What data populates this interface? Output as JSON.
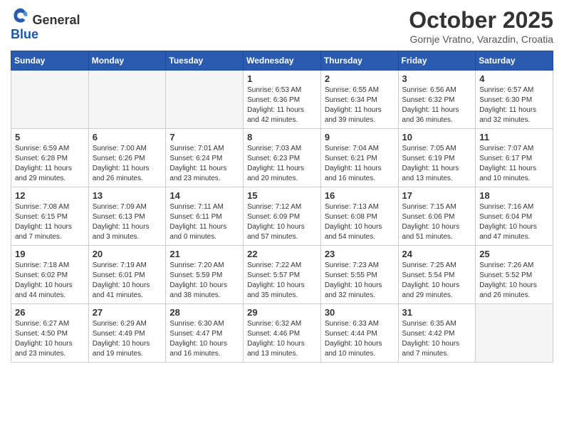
{
  "header": {
    "logo": {
      "general": "General",
      "blue": "Blue"
    },
    "title": "October 2025",
    "location": "Gornje Vratno, Varazdin, Croatia"
  },
  "days_of_week": [
    "Sunday",
    "Monday",
    "Tuesday",
    "Wednesday",
    "Thursday",
    "Friday",
    "Saturday"
  ],
  "weeks": [
    [
      {
        "day": "",
        "info": ""
      },
      {
        "day": "",
        "info": ""
      },
      {
        "day": "",
        "info": ""
      },
      {
        "day": "1",
        "info": "Sunrise: 6:53 AM\nSunset: 6:36 PM\nDaylight: 11 hours\nand 42 minutes."
      },
      {
        "day": "2",
        "info": "Sunrise: 6:55 AM\nSunset: 6:34 PM\nDaylight: 11 hours\nand 39 minutes."
      },
      {
        "day": "3",
        "info": "Sunrise: 6:56 AM\nSunset: 6:32 PM\nDaylight: 11 hours\nand 36 minutes."
      },
      {
        "day": "4",
        "info": "Sunrise: 6:57 AM\nSunset: 6:30 PM\nDaylight: 11 hours\nand 32 minutes."
      }
    ],
    [
      {
        "day": "5",
        "info": "Sunrise: 6:59 AM\nSunset: 6:28 PM\nDaylight: 11 hours\nand 29 minutes."
      },
      {
        "day": "6",
        "info": "Sunrise: 7:00 AM\nSunset: 6:26 PM\nDaylight: 11 hours\nand 26 minutes."
      },
      {
        "day": "7",
        "info": "Sunrise: 7:01 AM\nSunset: 6:24 PM\nDaylight: 11 hours\nand 23 minutes."
      },
      {
        "day": "8",
        "info": "Sunrise: 7:03 AM\nSunset: 6:23 PM\nDaylight: 11 hours\nand 20 minutes."
      },
      {
        "day": "9",
        "info": "Sunrise: 7:04 AM\nSunset: 6:21 PM\nDaylight: 11 hours\nand 16 minutes."
      },
      {
        "day": "10",
        "info": "Sunrise: 7:05 AM\nSunset: 6:19 PM\nDaylight: 11 hours\nand 13 minutes."
      },
      {
        "day": "11",
        "info": "Sunrise: 7:07 AM\nSunset: 6:17 PM\nDaylight: 11 hours\nand 10 minutes."
      }
    ],
    [
      {
        "day": "12",
        "info": "Sunrise: 7:08 AM\nSunset: 6:15 PM\nDaylight: 11 hours\nand 7 minutes."
      },
      {
        "day": "13",
        "info": "Sunrise: 7:09 AM\nSunset: 6:13 PM\nDaylight: 11 hours\nand 3 minutes."
      },
      {
        "day": "14",
        "info": "Sunrise: 7:11 AM\nSunset: 6:11 PM\nDaylight: 11 hours\nand 0 minutes."
      },
      {
        "day": "15",
        "info": "Sunrise: 7:12 AM\nSunset: 6:09 PM\nDaylight: 10 hours\nand 57 minutes."
      },
      {
        "day": "16",
        "info": "Sunrise: 7:13 AM\nSunset: 6:08 PM\nDaylight: 10 hours\nand 54 minutes."
      },
      {
        "day": "17",
        "info": "Sunrise: 7:15 AM\nSunset: 6:06 PM\nDaylight: 10 hours\nand 51 minutes."
      },
      {
        "day": "18",
        "info": "Sunrise: 7:16 AM\nSunset: 6:04 PM\nDaylight: 10 hours\nand 47 minutes."
      }
    ],
    [
      {
        "day": "19",
        "info": "Sunrise: 7:18 AM\nSunset: 6:02 PM\nDaylight: 10 hours\nand 44 minutes."
      },
      {
        "day": "20",
        "info": "Sunrise: 7:19 AM\nSunset: 6:01 PM\nDaylight: 10 hours\nand 41 minutes."
      },
      {
        "day": "21",
        "info": "Sunrise: 7:20 AM\nSunset: 5:59 PM\nDaylight: 10 hours\nand 38 minutes."
      },
      {
        "day": "22",
        "info": "Sunrise: 7:22 AM\nSunset: 5:57 PM\nDaylight: 10 hours\nand 35 minutes."
      },
      {
        "day": "23",
        "info": "Sunrise: 7:23 AM\nSunset: 5:55 PM\nDaylight: 10 hours\nand 32 minutes."
      },
      {
        "day": "24",
        "info": "Sunrise: 7:25 AM\nSunset: 5:54 PM\nDaylight: 10 hours\nand 29 minutes."
      },
      {
        "day": "25",
        "info": "Sunrise: 7:26 AM\nSunset: 5:52 PM\nDaylight: 10 hours\nand 26 minutes."
      }
    ],
    [
      {
        "day": "26",
        "info": "Sunrise: 6:27 AM\nSunset: 4:50 PM\nDaylight: 10 hours\nand 23 minutes."
      },
      {
        "day": "27",
        "info": "Sunrise: 6:29 AM\nSunset: 4:49 PM\nDaylight: 10 hours\nand 19 minutes."
      },
      {
        "day": "28",
        "info": "Sunrise: 6:30 AM\nSunset: 4:47 PM\nDaylight: 10 hours\nand 16 minutes."
      },
      {
        "day": "29",
        "info": "Sunrise: 6:32 AM\nSunset: 4:46 PM\nDaylight: 10 hours\nand 13 minutes."
      },
      {
        "day": "30",
        "info": "Sunrise: 6:33 AM\nSunset: 4:44 PM\nDaylight: 10 hours\nand 10 minutes."
      },
      {
        "day": "31",
        "info": "Sunrise: 6:35 AM\nSunset: 4:42 PM\nDaylight: 10 hours\nand 7 minutes."
      },
      {
        "day": "",
        "info": ""
      }
    ]
  ]
}
